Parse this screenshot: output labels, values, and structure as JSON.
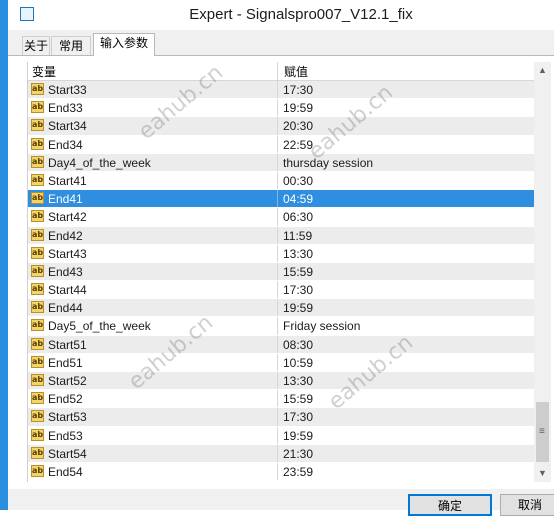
{
  "window": {
    "title": "Expert - Signalspro007_V12.1_fix"
  },
  "tabs": [
    {
      "label": "关于"
    },
    {
      "label": "常用"
    },
    {
      "label": "输入参数"
    }
  ],
  "grid": {
    "headers": {
      "variable": "变量",
      "value": "赋值"
    },
    "rows": [
      {
        "name": "Start33",
        "value": "17:30"
      },
      {
        "name": "End33",
        "value": "19:59"
      },
      {
        "name": "Start34",
        "value": "20:30"
      },
      {
        "name": "End34",
        "value": "22:59"
      },
      {
        "name": "Day4_of_the_week",
        "value": "thursday session"
      },
      {
        "name": "Start41",
        "value": "00:30"
      },
      {
        "name": "End41",
        "value": "04:59"
      },
      {
        "name": "Start42",
        "value": "06:30"
      },
      {
        "name": "End42",
        "value": "11:59"
      },
      {
        "name": "Start43",
        "value": "13:30"
      },
      {
        "name": "End43",
        "value": "15:59"
      },
      {
        "name": "Start44",
        "value": "17:30"
      },
      {
        "name": "End44",
        "value": "19:59"
      },
      {
        "name": "Day5_of_the_week",
        "value": "Friday session"
      },
      {
        "name": "Start51",
        "value": "08:30"
      },
      {
        "name": "End51",
        "value": "10:59"
      },
      {
        "name": "Start52",
        "value": "13:30"
      },
      {
        "name": "End52",
        "value": "15:59"
      },
      {
        "name": "Start53",
        "value": "17:30"
      },
      {
        "name": "End53",
        "value": "19:59"
      },
      {
        "name": "Start54",
        "value": "21:30"
      },
      {
        "name": "End54",
        "value": "23:59"
      }
    ],
    "selected_row": "End41",
    "type_badge": "ab"
  },
  "buttons": {
    "ok": "确定",
    "cancel": "取消"
  },
  "watermark": "eahub.cn",
  "colors": {
    "selection": "#2f8ee0",
    "odd_row": "#ececec",
    "window_edge": "#2b8fe0"
  }
}
